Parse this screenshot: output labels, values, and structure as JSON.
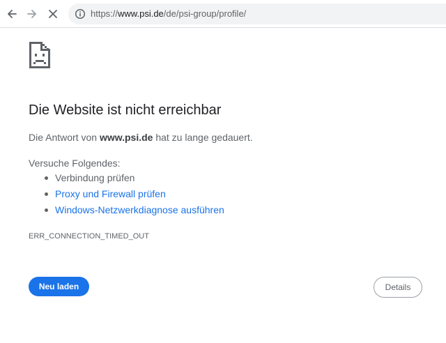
{
  "browser": {
    "url_prefix": "https://",
    "url_host": "www.psi.de",
    "url_path": "/de/psi-group/profile/",
    "icons": {
      "back": "arrow-left-icon",
      "forward": "arrow-right-icon",
      "stop": "close-icon",
      "site_info": "info-icon"
    }
  },
  "error_page": {
    "icon": "sad-document-icon",
    "title": "Die Website ist nicht erreichbar",
    "summary_prefix": "Die Antwort von ",
    "summary_host": "www.psi.de",
    "summary_suffix": " hat zu lange gedauert.",
    "suggestions_header": "Versuche Folgendes:",
    "suggestions": [
      {
        "label": "Verbindung prüfen",
        "link": false
      },
      {
        "label": "Proxy und Firewall prüfen",
        "link": true
      },
      {
        "label": "Windows-Netzwerkdiagnose ausführen",
        "link": true
      }
    ],
    "error_code": "ERR_CONNECTION_TIMED_OUT",
    "reload_label": "Neu laden",
    "details_label": "Details",
    "colors": {
      "primary": "#1a73e8",
      "text": "#202124",
      "secondary_text": "#5f6368"
    }
  }
}
